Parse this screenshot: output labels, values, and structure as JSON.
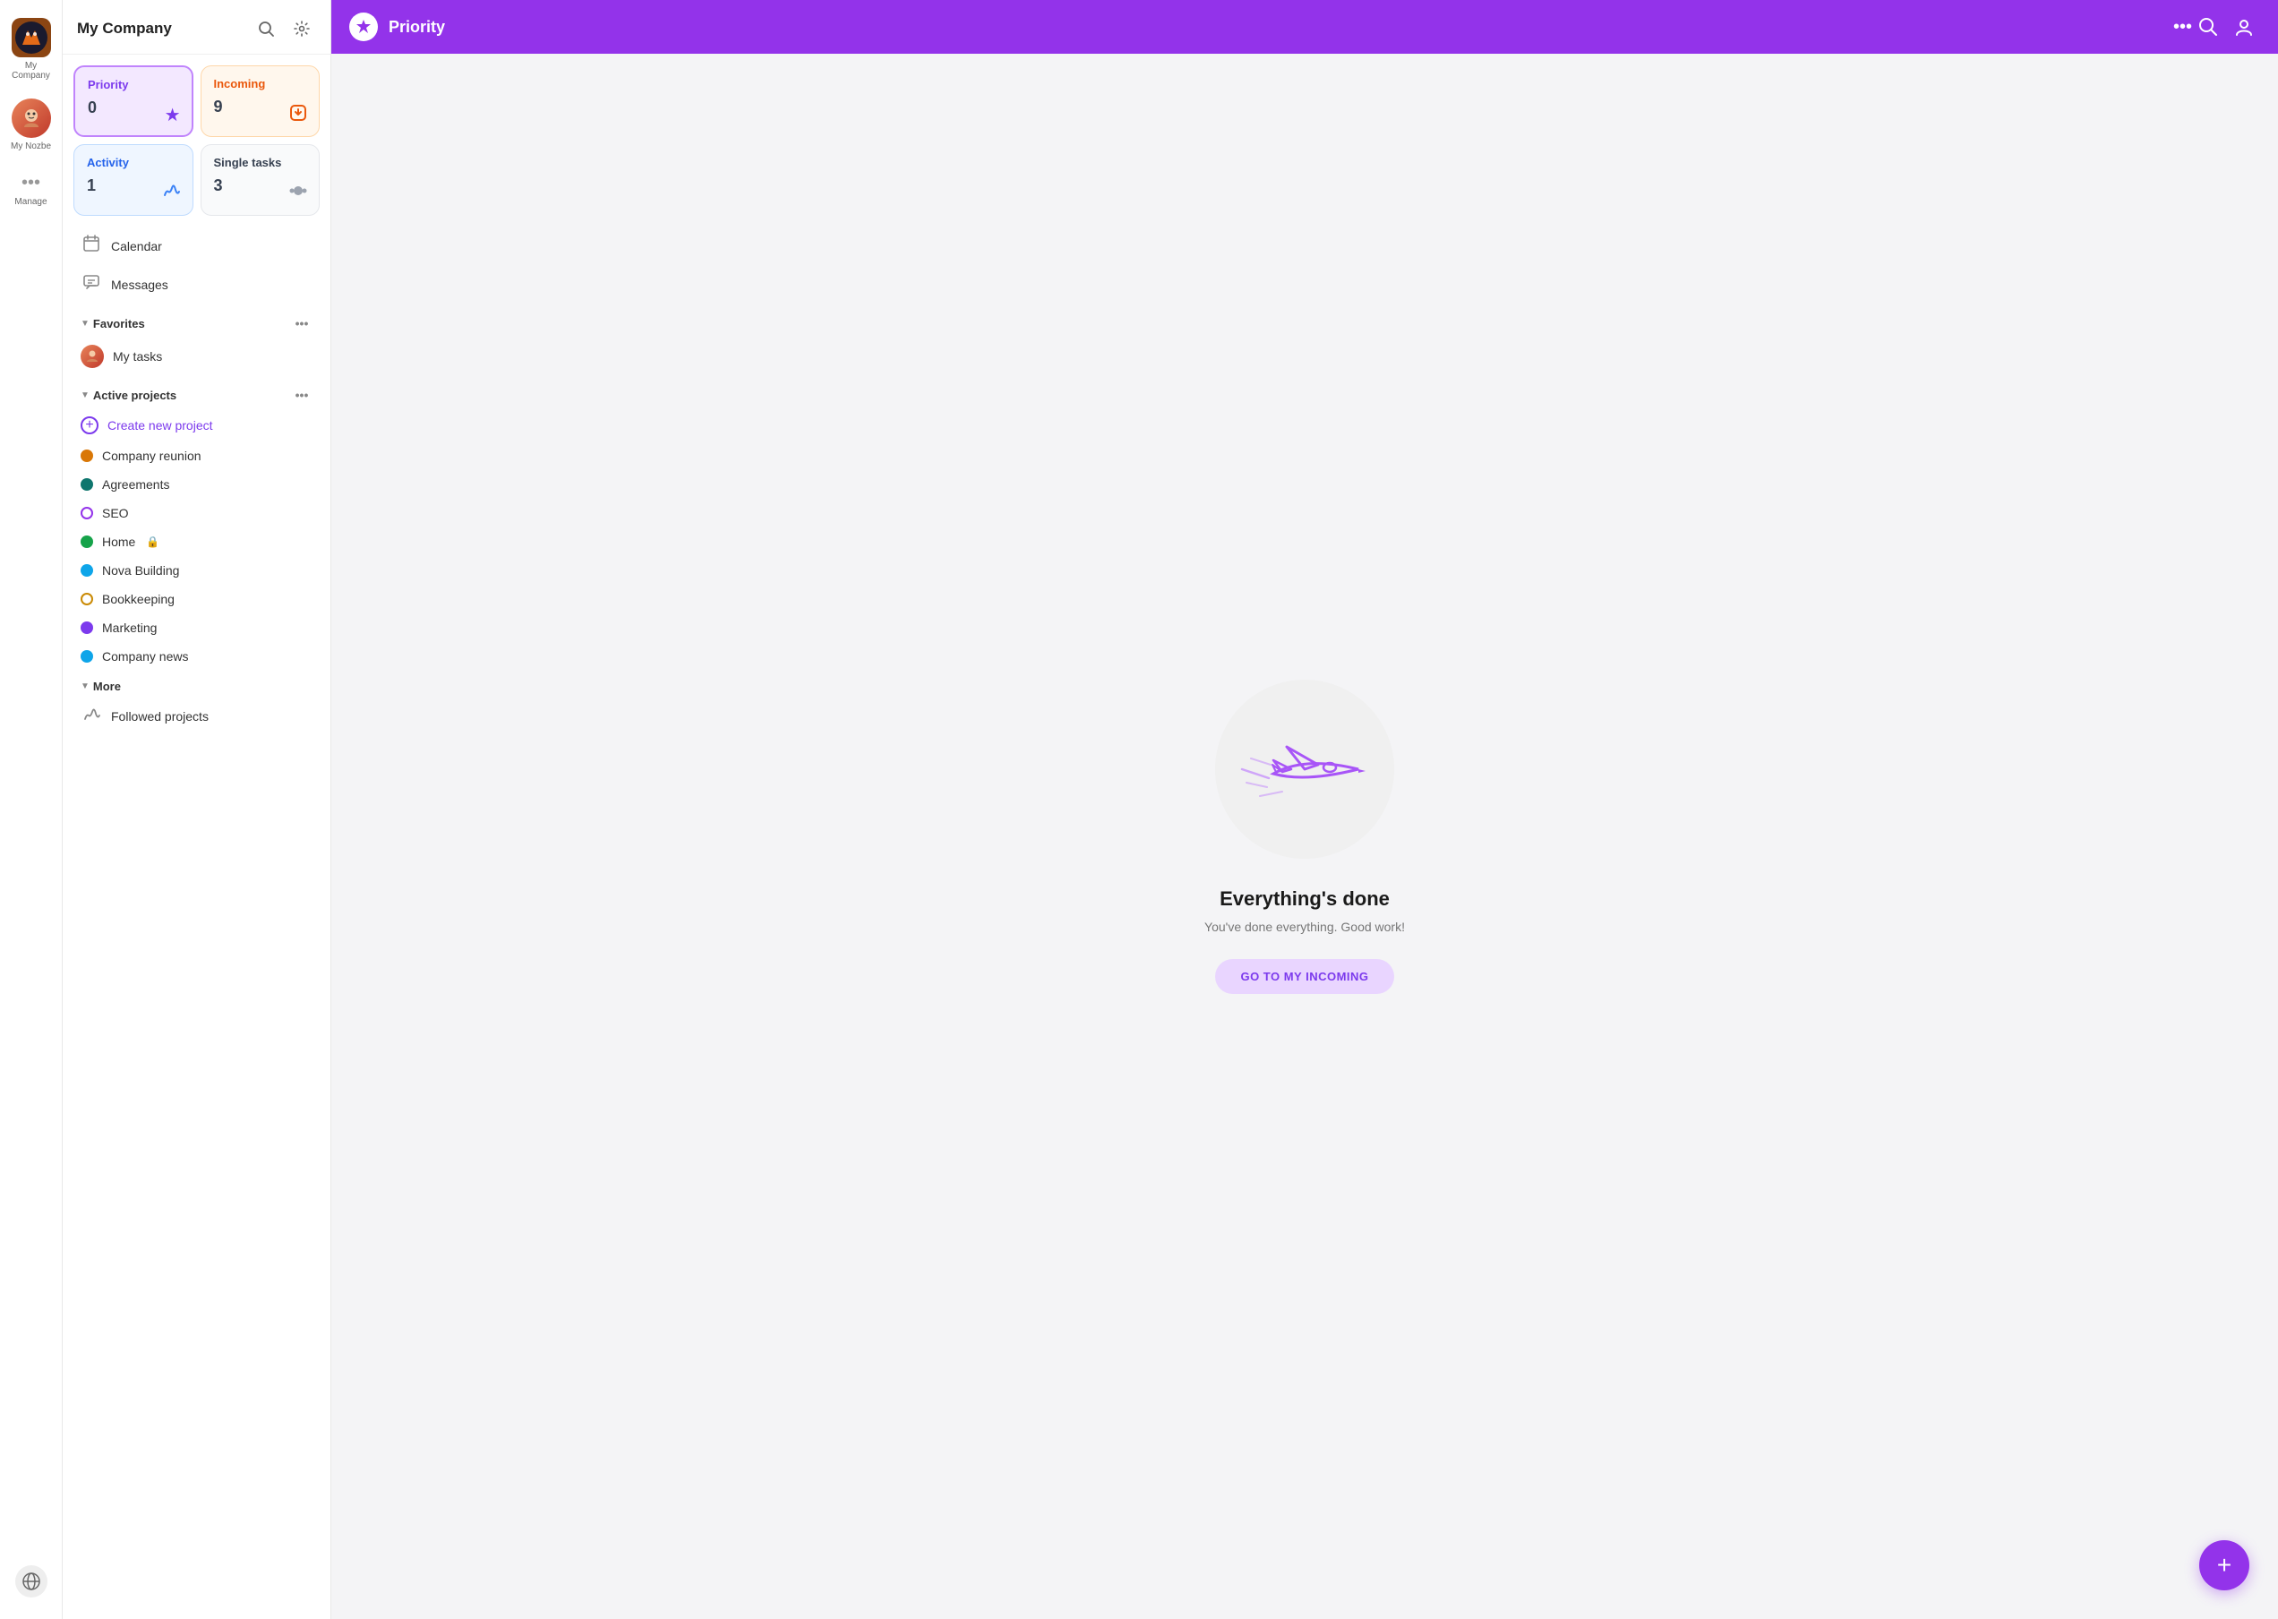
{
  "iconBar": {
    "companyLabel": "My Company",
    "nozbeLabel": "My Nozbe",
    "manageLabel": "Manage"
  },
  "sidebar": {
    "title": "My Company",
    "searchAriaLabel": "Search",
    "settingsAriaLabel": "Settings",
    "quickCards": [
      {
        "id": "priority",
        "label": "Priority",
        "count": "0",
        "iconSymbol": "★",
        "type": "priority"
      },
      {
        "id": "incoming",
        "label": "Incoming",
        "count": "9",
        "iconSymbol": "⬇",
        "type": "incoming"
      },
      {
        "id": "activity",
        "label": "Activity",
        "count": "1",
        "iconSymbol": "📡",
        "type": "activity"
      },
      {
        "id": "single-tasks",
        "label": "Single tasks",
        "count": "3",
        "iconSymbol": "⬟",
        "type": "single-tasks"
      }
    ],
    "navItems": [
      {
        "id": "calendar",
        "label": "Calendar",
        "icon": "📅"
      },
      {
        "id": "messages",
        "label": "Messages",
        "icon": "💬"
      }
    ],
    "favorites": {
      "label": "Favorites",
      "items": [
        {
          "id": "my-tasks",
          "label": "My tasks"
        }
      ]
    },
    "activeProjects": {
      "label": "Active projects",
      "createLabel": "Create new project",
      "items": [
        {
          "id": "company-reunion",
          "label": "Company reunion",
          "color": "#d97706",
          "hollow": false
        },
        {
          "id": "agreements",
          "label": "Agreements",
          "color": "#0f766e",
          "hollow": false
        },
        {
          "id": "seo",
          "label": "SEO",
          "color": "#9333ea",
          "hollow": true,
          "borderColor": "#9333ea"
        },
        {
          "id": "home",
          "label": "Home",
          "color": "#16a34a",
          "hollow": false,
          "locked": true
        },
        {
          "id": "nova-building",
          "label": "Nova Building",
          "color": "#0ea5e9",
          "hollow": false
        },
        {
          "id": "bookkeeping",
          "label": "Bookkeeping",
          "color": "#ca8a04",
          "hollow": true,
          "borderColor": "#ca8a04"
        },
        {
          "id": "marketing",
          "label": "Marketing",
          "color": "#7c3aed",
          "hollow": false
        },
        {
          "id": "company-news",
          "label": "Company news",
          "color": "#0ea5e9",
          "hollow": false
        }
      ]
    },
    "more": {
      "label": "More",
      "items": [
        {
          "id": "followed-projects",
          "label": "Followed projects",
          "icon": "📡"
        }
      ]
    }
  },
  "mainHeader": {
    "title": "Priority",
    "searchLabel": "Search"
  },
  "emptyState": {
    "title": "Everything's done",
    "subtitle": "You've done everything. Good work!",
    "buttonLabel": "GO TO MY INCOMING"
  },
  "fab": {
    "label": "+"
  }
}
